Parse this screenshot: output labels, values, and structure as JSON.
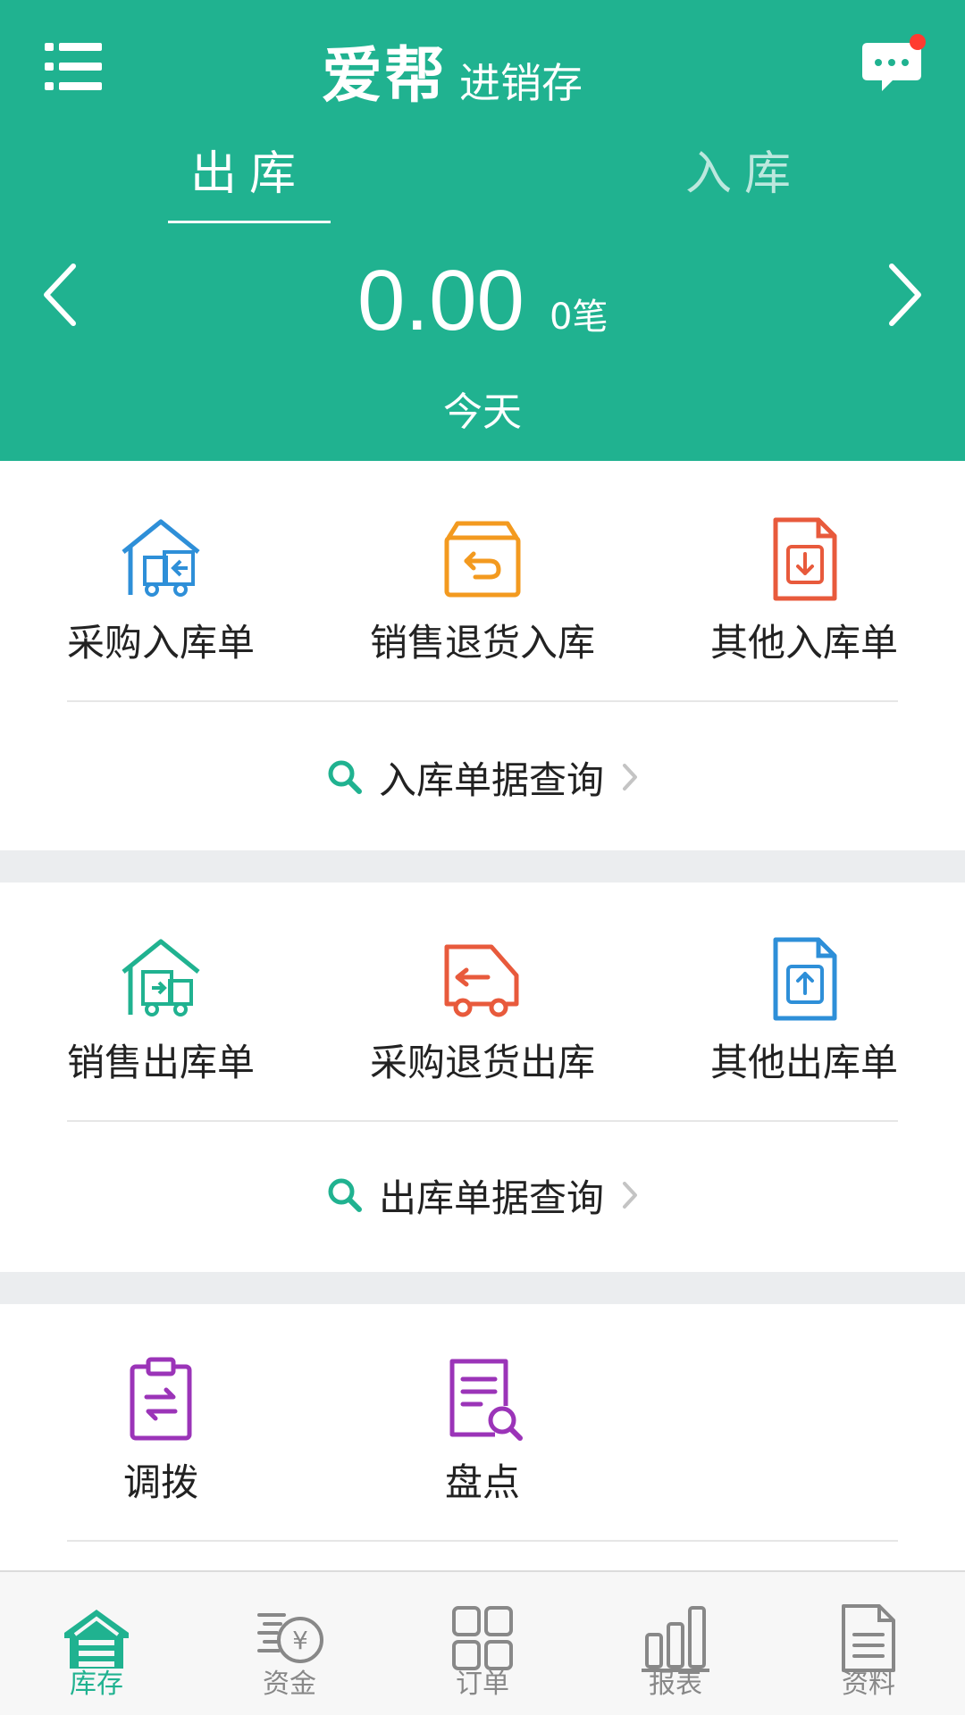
{
  "header": {
    "logo_main": "爱帮",
    "logo_sub": "进销存",
    "tabs": [
      {
        "label": "出库",
        "active": true
      },
      {
        "label": "入库",
        "active": false
      }
    ],
    "amount": "0.00",
    "count": "0笔",
    "period": "今天",
    "notification_dot": true
  },
  "inbound": {
    "items": [
      {
        "label": "采购入库单",
        "icon": "warehouse-truck-in-icon"
      },
      {
        "label": "销售退货入库",
        "icon": "box-return-icon"
      },
      {
        "label": "其他入库单",
        "icon": "file-download-icon"
      }
    ],
    "query_label": "入库单据查询"
  },
  "outbound": {
    "items": [
      {
        "label": "销售出库单",
        "icon": "warehouse-truck-out-icon"
      },
      {
        "label": "采购退货出库",
        "icon": "truck-return-icon"
      },
      {
        "label": "其他出库单",
        "icon": "file-upload-icon"
      }
    ],
    "query_label": "出库单据查询"
  },
  "tools": {
    "items": [
      {
        "label": "调拨",
        "icon": "clipboard-transfer-icon"
      },
      {
        "label": "盘点",
        "icon": "document-search-icon"
      }
    ]
  },
  "tabbar": {
    "items": [
      {
        "label": "库存",
        "icon": "warehouse-icon",
        "active": true
      },
      {
        "label": "资金",
        "icon": "money-icon",
        "active": false
      },
      {
        "label": "订单",
        "icon": "grid-icon",
        "active": false
      },
      {
        "label": "报表",
        "icon": "bar-chart-icon",
        "active": false
      },
      {
        "label": "资料",
        "icon": "document-icon",
        "active": false
      }
    ]
  },
  "colors": {
    "brand": "#20b290",
    "blue": "#2e8fd8",
    "orange": "#f39a1f",
    "red": "#e85a3c",
    "purple": "#9b34b8",
    "notification": "#ff3b30"
  }
}
